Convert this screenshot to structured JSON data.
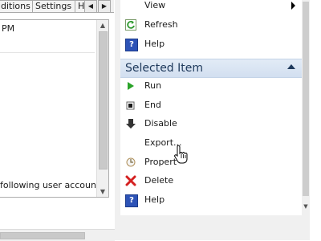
{
  "left_pane": {
    "tabs": [
      "ditions",
      "Settings",
      "H"
    ],
    "tab_scroll_left": "◀",
    "tab_scroll_right": "▶",
    "list_value": "PM",
    "description_fragment": "following user account:"
  },
  "actions": {
    "top_items": [
      {
        "label": "View",
        "icon": "none",
        "has_submenu": true
      },
      {
        "label": "Refresh",
        "icon": "refresh-icon"
      },
      {
        "label": "Help",
        "icon": "help-icon"
      }
    ],
    "section_title": "Selected Item",
    "selected_items": [
      {
        "label": "Run",
        "icon": "run-icon"
      },
      {
        "label": "End",
        "icon": "end-icon"
      },
      {
        "label": "Disable",
        "icon": "disable-icon"
      },
      {
        "label": "Export...",
        "icon": "none"
      },
      {
        "label": "Propert",
        "icon": "properties-icon"
      },
      {
        "label": "Delete",
        "icon": "delete-icon"
      },
      {
        "label": "Help",
        "icon": "help-icon"
      }
    ]
  },
  "colors": {
    "section_header": "#d2dff0",
    "section_text": "#1e395b",
    "run_green": "#2aa329",
    "delete_red": "#d42020",
    "help_blue": "#2d53b7"
  }
}
